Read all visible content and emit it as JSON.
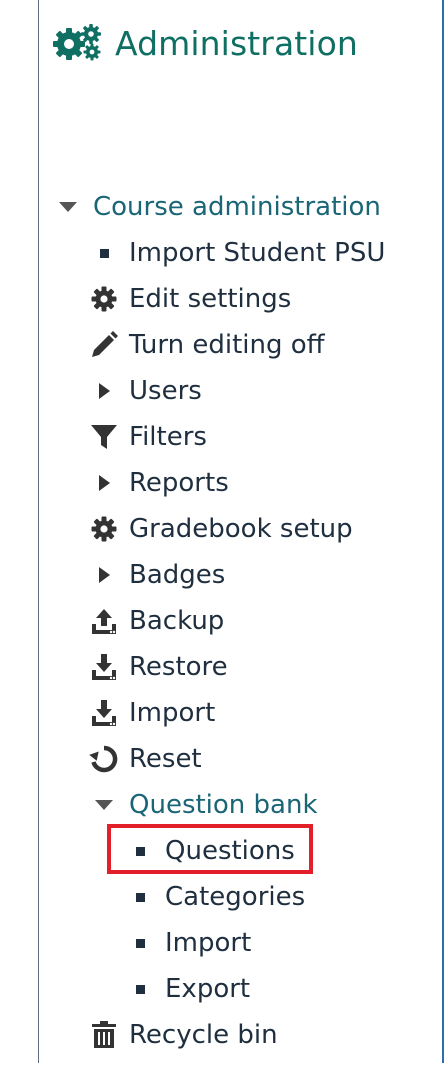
{
  "block": {
    "title": "Administration",
    "title_icon": "gears-icon",
    "accent_color": "#0f6f63",
    "border_color": "#2b6fb2"
  },
  "tree": {
    "course_administration": "Course administration",
    "items": [
      {
        "label": "Import Student PSU",
        "icon": "bullet"
      },
      {
        "label": "Edit settings",
        "icon": "gear-icon"
      },
      {
        "label": "Turn editing off",
        "icon": "pencil-icon"
      },
      {
        "label": "Users",
        "icon": "caret-right-icon"
      },
      {
        "label": "Filters",
        "icon": "filter-icon"
      },
      {
        "label": "Reports",
        "icon": "caret-right-icon"
      },
      {
        "label": "Gradebook setup",
        "icon": "gear-icon"
      },
      {
        "label": "Badges",
        "icon": "caret-right-icon"
      },
      {
        "label": "Backup",
        "icon": "upload-icon"
      },
      {
        "label": "Restore",
        "icon": "download-icon"
      },
      {
        "label": "Import",
        "icon": "download-icon"
      },
      {
        "label": "Reset",
        "icon": "reset-icon"
      }
    ],
    "question_bank": {
      "label": "Question bank",
      "children": [
        {
          "label": "Questions"
        },
        {
          "label": "Categories"
        },
        {
          "label": "Import"
        },
        {
          "label": "Export"
        }
      ]
    },
    "recycle_bin": "Recycle bin",
    "highlighted_item": "Questions",
    "highlight_color": "#e3202a"
  }
}
